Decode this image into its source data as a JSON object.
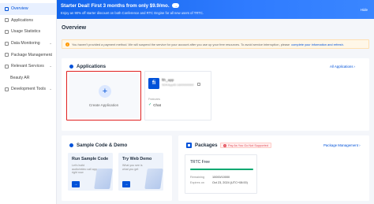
{
  "sidebar": {
    "items": [
      {
        "label": "Overview",
        "active": true
      },
      {
        "label": "Applications"
      },
      {
        "label": "Usage Statistics"
      },
      {
        "label": "Data Monitoring"
      },
      {
        "label": "Package Management"
      },
      {
        "label": "Relevant Services"
      },
      {
        "label": "Beauty AR"
      },
      {
        "label": "Development Tools"
      }
    ],
    "chevron": "⌄"
  },
  "banner": {
    "title": "Starter Deal! First 3 months from only $9.9/mo.",
    "badge": "→",
    "subtitle": "Enjoy an 90% off starter discount on both Conference and RTC Engine for all new users of TRTC.",
    "hide": "Hide"
  },
  "page_title": "Overview",
  "notice": {
    "icon": "!",
    "text": "You haven't provided a payment method. We will suspend the service for your account after you use up your free resources. To avoid service interruption, please",
    "link": "complete your information and refresh."
  },
  "applications": {
    "title": "Applications",
    "all_link": "All Applications ›",
    "create_label": "Create Application",
    "plus": "+",
    "app": {
      "icon_letter": "fi",
      "name": "fth_app",
      "sub_id": "SDKAppID:1600000000",
      "feature_label": "Features",
      "feature_value": "Chat"
    }
  },
  "sample": {
    "title": "Sample Code & Demo",
    "demos": [
      {
        "title": "Run Sample Code",
        "desc": "Let's build audio/video call app right now",
        "arrow": "→"
      },
      {
        "title": "Try Web Demo",
        "desc": "What you see is what you get",
        "arrow": "→"
      }
    ]
  },
  "packages": {
    "title": "Packages",
    "warning": "Pay As You Go Not Supported",
    "manage_link": "Package Management ›",
    "item": {
      "name": "TRTC Free",
      "remaining_label": "Remaining",
      "remaining_value": "10000/10000",
      "expires_label": "Expires on",
      "expires_value": "Oct 23, 2024 (UTC+08:00)",
      "progress": 1.0
    }
  },
  "colors": {
    "accent": "#0052d9",
    "banner": "#1366ec",
    "alert": "#e34d59",
    "success": "#00a870"
  }
}
